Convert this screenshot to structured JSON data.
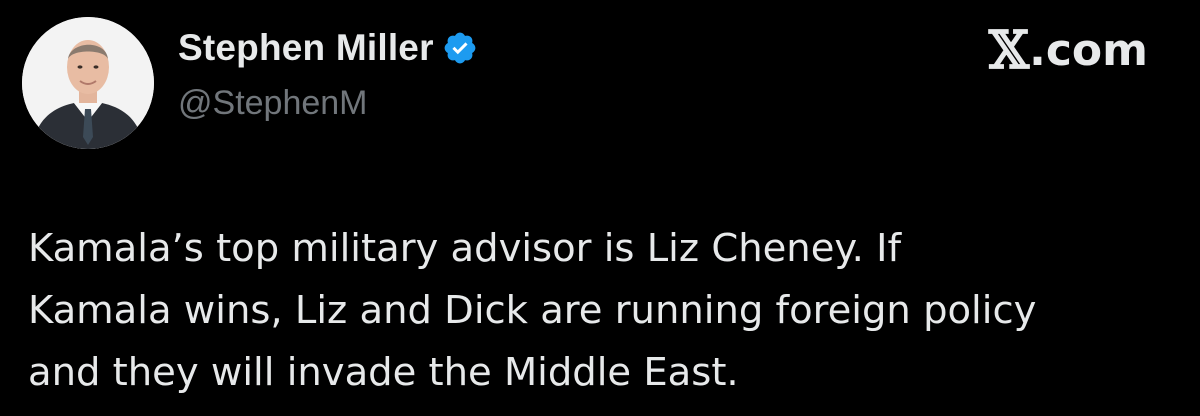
{
  "author": {
    "display_name": "Stephen Miller",
    "handle": "@StephenM",
    "verified_icon": "verified-badge-icon",
    "verified_color": "#1d9bf0",
    "avatar": "profile-photo"
  },
  "site": {
    "label": ".com",
    "logo_glyph": "𝕏"
  },
  "tweet": {
    "lines": [
      "Kamala’s top military advisor is Liz Cheney. If",
      "Kamala wins, Liz and Dick are running foreign policy",
      "and they will invade the Middle East."
    ]
  },
  "colors": {
    "background": "#000000",
    "primary_text": "#e7e9ea",
    "secondary_text": "#71767b"
  }
}
